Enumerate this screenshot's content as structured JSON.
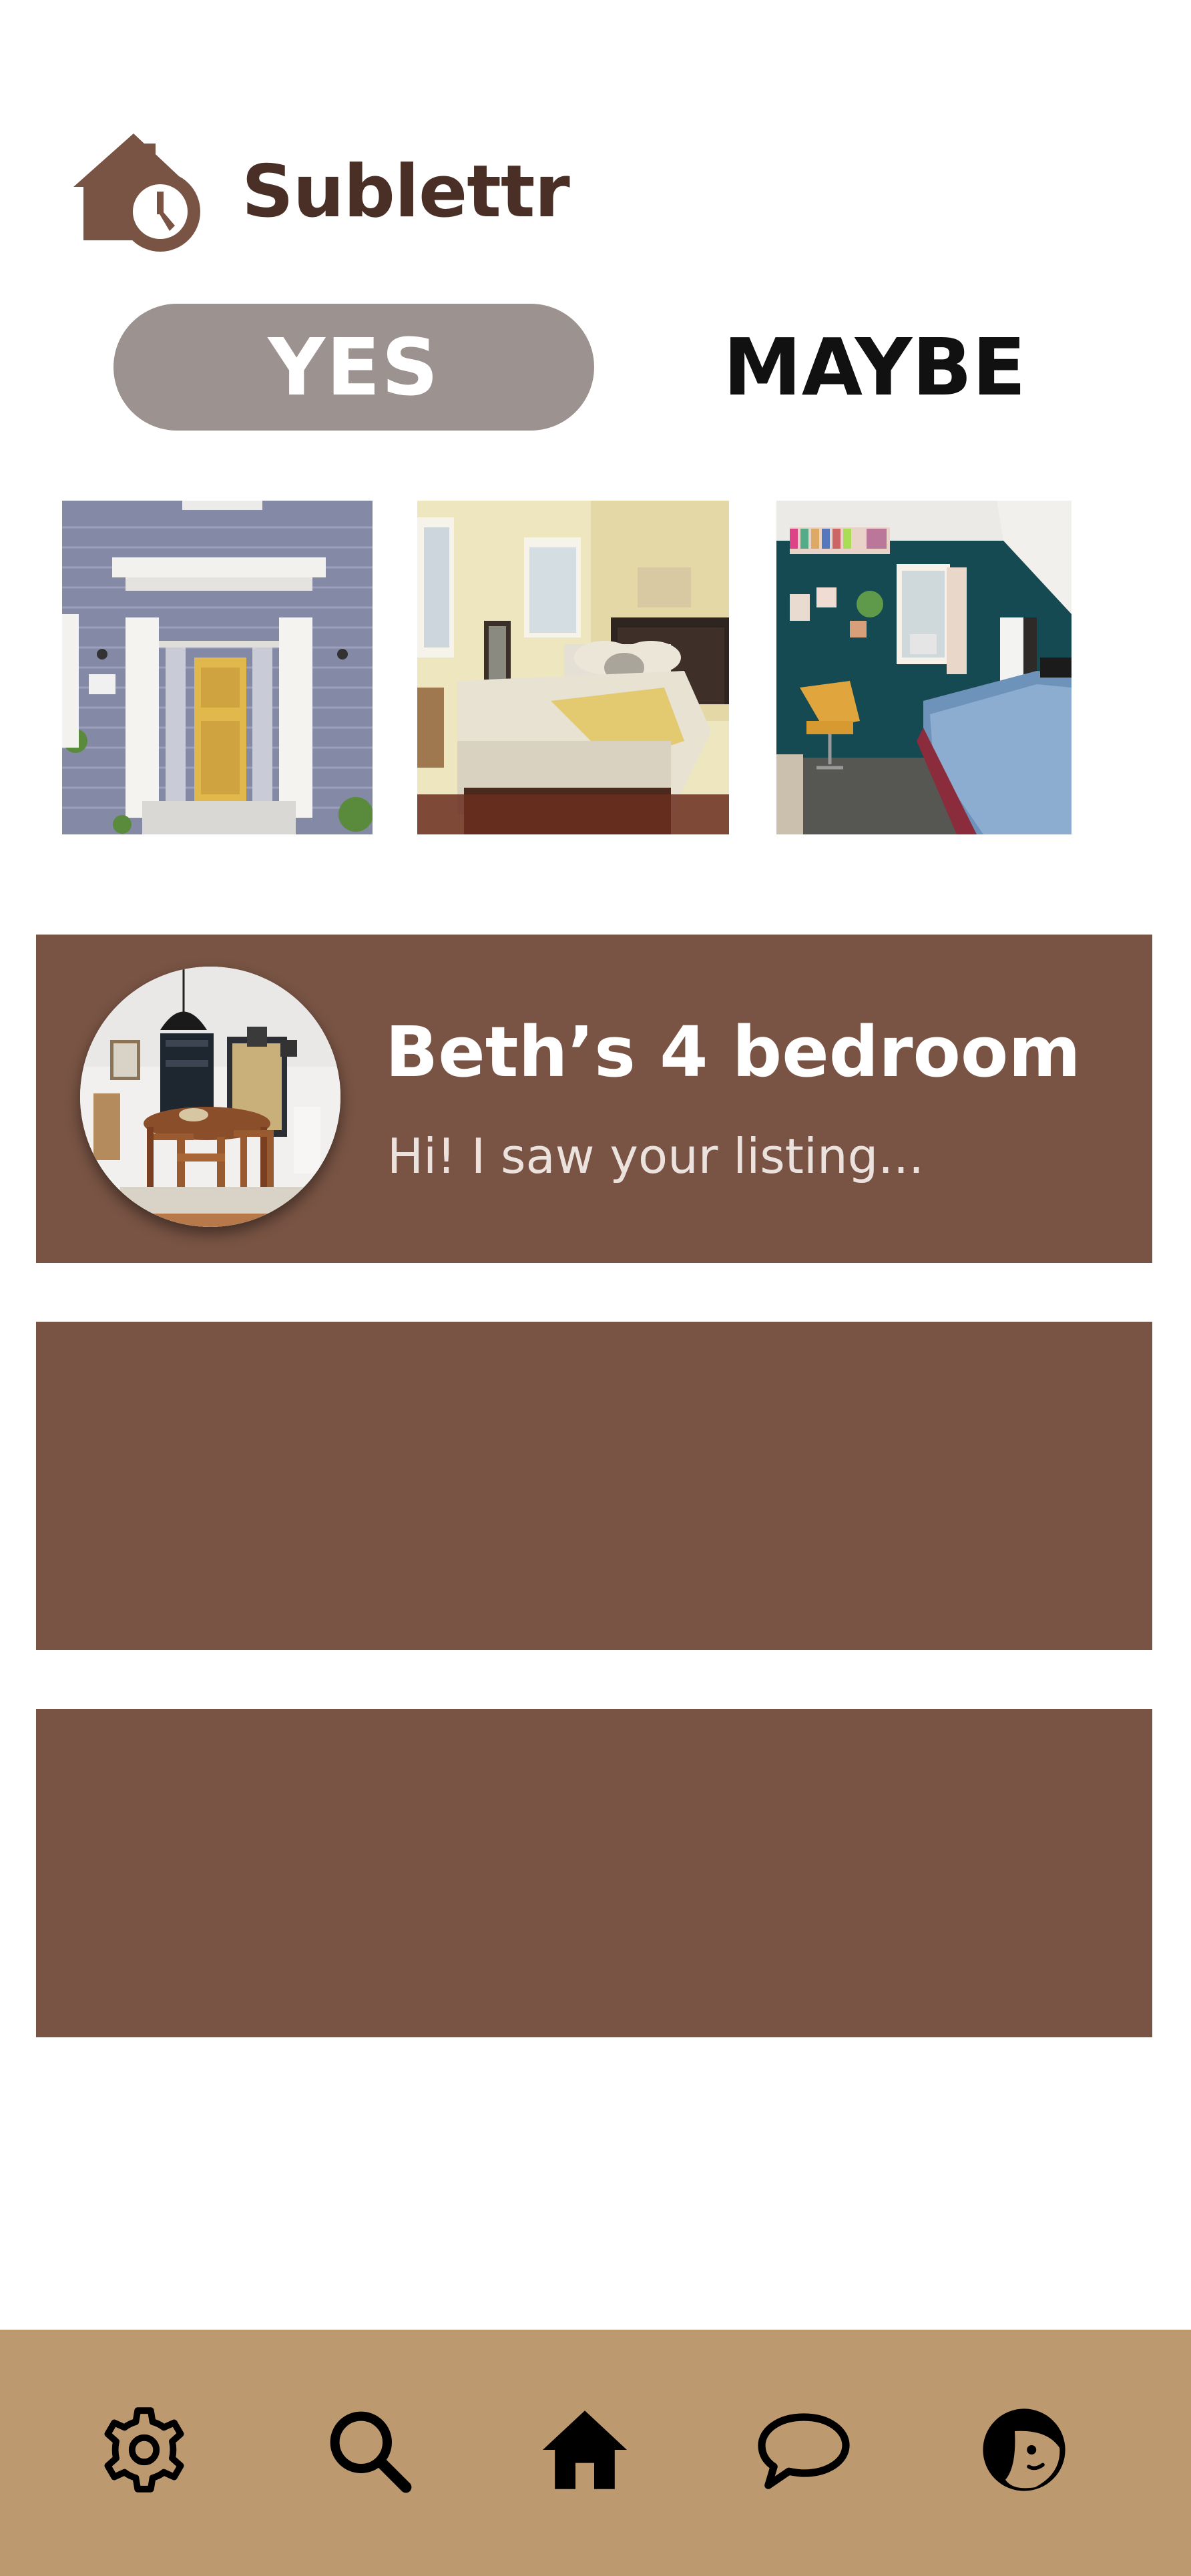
{
  "app": {
    "name": "Sublettr",
    "logo_icon": "house-clock-icon",
    "brand_color": "#795444"
  },
  "tabs": [
    {
      "label": "YES",
      "selected": true
    },
    {
      "label": "MAYBE",
      "selected": false
    }
  ],
  "photos": [
    {
      "name": "house-front-door-photo"
    },
    {
      "name": "bedroom-photo"
    },
    {
      "name": "teal-bedroom-photo"
    }
  ],
  "conversations": [
    {
      "title": "Beth’s 4 bedroom",
      "preview": "Hi! I saw your listing...",
      "avatar": "dining-room-photo"
    },
    {
      "title": "",
      "preview": ""
    },
    {
      "title": "",
      "preview": ""
    }
  ],
  "bottom_nav": {
    "background": "#bd996f",
    "items": [
      {
        "icon": "gear-icon"
      },
      {
        "icon": "search-icon"
      },
      {
        "icon": "home-icon"
      },
      {
        "icon": "chat-bubble-icon"
      },
      {
        "icon": "profile-icon"
      }
    ]
  }
}
